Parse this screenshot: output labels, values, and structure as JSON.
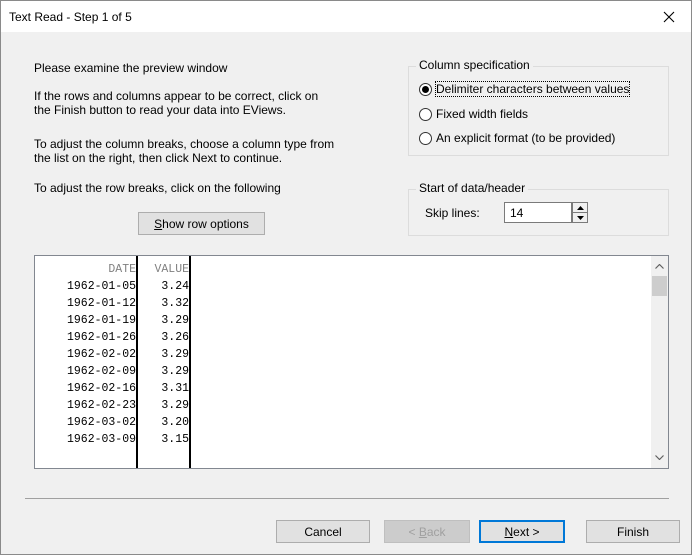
{
  "window": {
    "title": "Text Read - Step 1 of 5"
  },
  "instructions": {
    "line1": "Please examine the preview window",
    "para2_line1": "If the rows and columns appear to be correct, click on",
    "para2_line2": "the Finish button to read your data into EViews.",
    "para3_line1": "To adjust the column breaks, choose a column type from",
    "para3_line2": "the list on the right, then click Next to continue.",
    "para4": "To adjust the row breaks, click on the following"
  },
  "show_row_options": {
    "accel": "S",
    "rest": "how row options"
  },
  "column_spec": {
    "label": "Column specification",
    "options": [
      {
        "accel": "D",
        "rest": "elimiter characters between values",
        "selected": true
      },
      {
        "accel": "F",
        "rest": "ixed width fields",
        "selected": false
      },
      {
        "accel": "A",
        "rest": "n explicit format (to be provided)",
        "selected": false
      }
    ]
  },
  "start_data": {
    "label": "Start of data/header",
    "skip_label": "Skip lines:",
    "skip_value": "14"
  },
  "preview": {
    "headers": [
      "DATE",
      "VALUE"
    ],
    "rows": [
      [
        "1962-01-05",
        "3.24"
      ],
      [
        "1962-01-12",
        "3.32"
      ],
      [
        "1962-01-19",
        "3.29"
      ],
      [
        "1962-01-26",
        "3.26"
      ],
      [
        "1962-02-02",
        "3.29"
      ],
      [
        "1962-02-09",
        "3.29"
      ],
      [
        "1962-02-16",
        "3.31"
      ],
      [
        "1962-02-23",
        "3.29"
      ],
      [
        "1962-03-02",
        "3.20"
      ],
      [
        "1962-03-09",
        "3.15"
      ]
    ]
  },
  "buttons": {
    "cancel": "Cancel",
    "back_accel": "B",
    "back_pre": "< ",
    "back_rest": "ack",
    "next_accel": "N",
    "next_rest": "ext >",
    "finish": "Finish"
  },
  "icons": {
    "close": "close-icon",
    "spin_up": "spin-up-icon",
    "spin_down": "spin-down-icon",
    "scroll_up": "chevron-up-icon",
    "scroll_down": "chevron-down-icon"
  }
}
